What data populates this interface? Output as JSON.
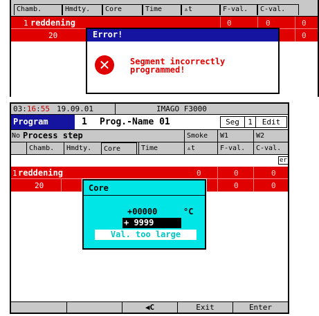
{
  "back_screen": {
    "headers": [
      "Chamb.",
      "Hmdty.",
      "Core",
      "Time",
      "▵t",
      "F-val.",
      "C-val."
    ],
    "row1": {
      "num": "1",
      "name": "reddening",
      "vals": [
        "0",
        "0",
        "0"
      ]
    },
    "row2": {
      "num": "20",
      "vals": [
        "0",
        "0"
      ]
    },
    "error_dialog": {
      "title": "Error!",
      "icon": "error-x-icon",
      "message": "Segment incorrectly\nprogrammed!"
    },
    "colors": {
      "row_red": "#e10000",
      "dialog_title": "#1414a0"
    }
  },
  "front_screen": {
    "status": {
      "time_h": "03",
      "time_m": "16",
      "time_s": "55",
      "date": "19.09.01",
      "device": "IMAGO F3000"
    },
    "program": {
      "label": "Program",
      "number": "1",
      "name": "Prog.-Name 01",
      "seg_label": "Seg",
      "seg_value": "1",
      "mode": "Edit"
    },
    "header1": {
      "no": "No",
      "process_step": "Process step",
      "smoke": "Smoke",
      "w1": "W1",
      "w2": "W2"
    },
    "header2": {
      "chamb": "Chamb.",
      "hmdty": "Hmdty.",
      "core": "Core",
      "time": "Time",
      "delta_t": "▵t",
      "fval": "F-val.",
      "cval": "C-val."
    },
    "row1": {
      "num": "1",
      "name": "reddening",
      "vals": [
        "0",
        "0",
        "0"
      ]
    },
    "row2": {
      "num": "20",
      "vals": [
        "0",
        "0"
      ]
    },
    "side_tab": "er",
    "core_popup": {
      "title": "Core",
      "current_value": "+00000",
      "unit": "°C",
      "input_value": "+ 9999",
      "warning": "Val. too large"
    },
    "fn_keys": [
      "",
      "",
      "◀C",
      "Exit",
      "Enter"
    ],
    "colors": {
      "program_label": "#1414a0",
      "popup": "#00e6e6",
      "row_red": "#e10000"
    }
  }
}
